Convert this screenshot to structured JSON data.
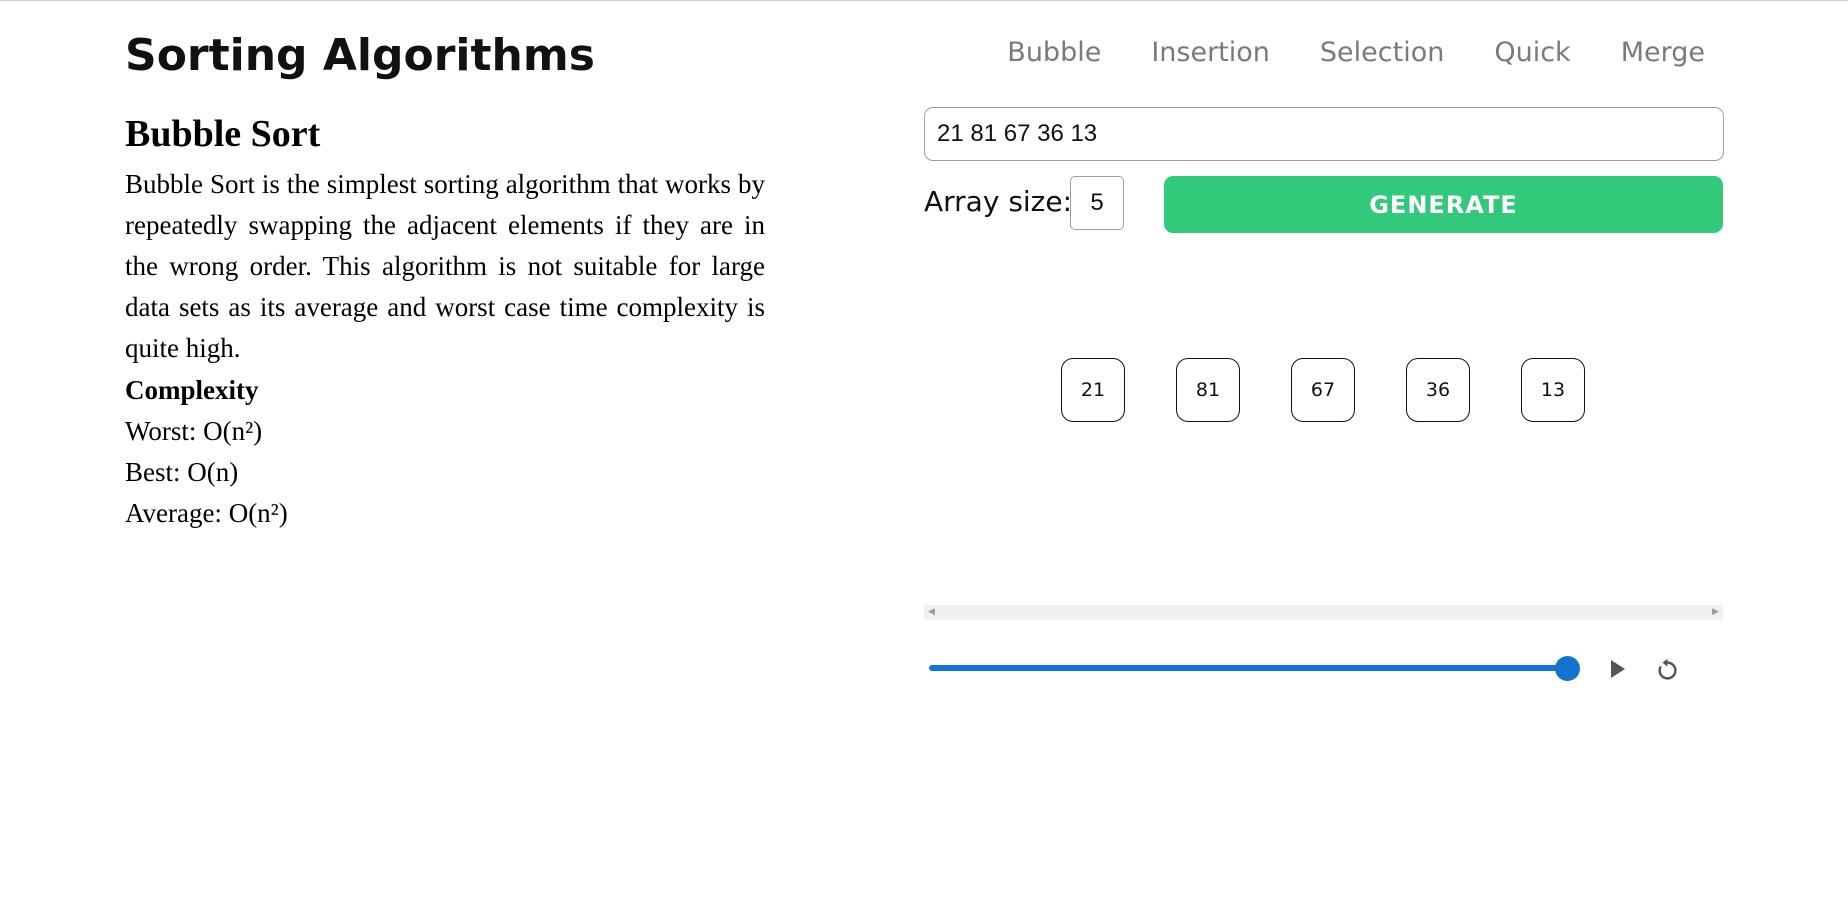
{
  "header": {
    "title": "Sorting Algorithms",
    "nav": [
      "Bubble",
      "Insertion",
      "Selection",
      "Quick",
      "Merge"
    ]
  },
  "info": {
    "title": "Bubble Sort",
    "description": "Bubble Sort is the simplest sorting algorithm that works by repeatedly swapping the adjacent elements if they are in the wrong order. This algorithm is not suitable for large data sets as its average and worst case time complexity is quite high.",
    "complexity_heading": "Complexity",
    "worst": "Worst: O(n²)",
    "best": "Best: O(n)",
    "average": "Average: O(n²)"
  },
  "controls": {
    "array_input_value": "21 81 67 36 13",
    "size_label": "Array size:",
    "size_value": "5",
    "generate_label": "GENERATE"
  },
  "array": [
    "21",
    "81",
    "67",
    "36",
    "13"
  ],
  "player": {
    "progress": 1.0,
    "play_icon": "play-icon",
    "reset_icon": "reset-icon"
  },
  "colors": {
    "accent_green": "#33c97b",
    "slider_blue": "#1274cf",
    "nav_gray": "#7a7a7a"
  }
}
